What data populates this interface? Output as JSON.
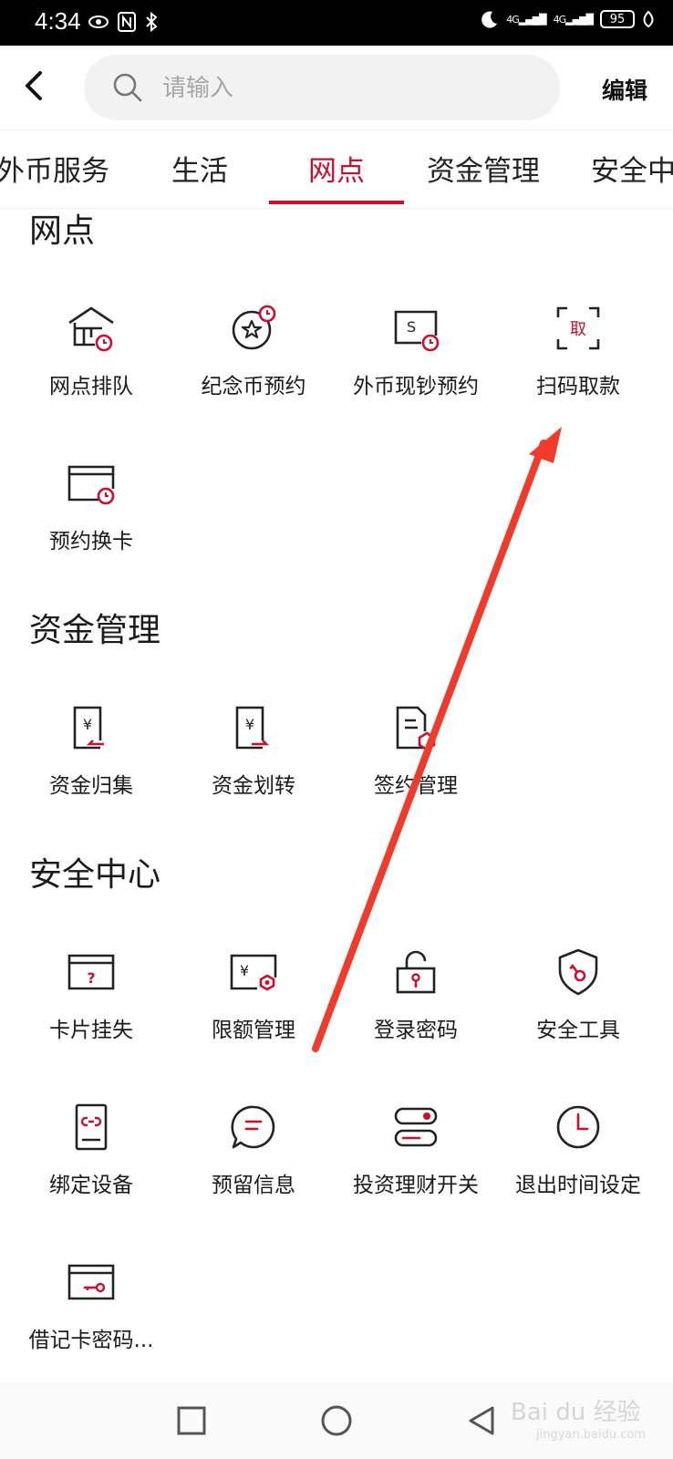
{
  "status_bar": {
    "time": "4:34",
    "network": "4G",
    "battery": "95"
  },
  "search": {
    "placeholder": "请输入"
  },
  "header": {
    "edit_label": "编辑"
  },
  "tabs": [
    "外币服务",
    "生活",
    "网点",
    "资金管理",
    "安全中"
  ],
  "active_tab": "网点",
  "colors": {
    "accent": "#c8102e",
    "text": "#1a1a1a",
    "icon": "#222222"
  },
  "sections": [
    {
      "title": "网点",
      "items": [
        {
          "label": "网点排队",
          "icon": "bank-queue-icon"
        },
        {
          "label": "纪念币预约",
          "icon": "commemorative-coin-icon"
        },
        {
          "label": "外币现钞预约",
          "icon": "foreign-cash-icon"
        },
        {
          "label": "扫码取款",
          "icon": "scan-withdraw-icon"
        },
        {
          "label": "预约换卡",
          "icon": "card-replace-icon"
        }
      ]
    },
    {
      "title": "资金管理",
      "items": [
        {
          "label": "资金归集",
          "icon": "fund-collect-icon"
        },
        {
          "label": "资金划转",
          "icon": "fund-transfer-icon"
        },
        {
          "label": "签约管理",
          "icon": "contract-icon"
        }
      ]
    },
    {
      "title": "安全中心",
      "items": [
        {
          "label": "卡片挂失",
          "icon": "card-loss-icon"
        },
        {
          "label": "限额管理",
          "icon": "limit-icon"
        },
        {
          "label": "登录密码",
          "icon": "login-lock-icon"
        },
        {
          "label": "安全工具",
          "icon": "shield-key-icon"
        },
        {
          "label": "绑定设备",
          "icon": "device-bind-icon"
        },
        {
          "label": "预留信息",
          "icon": "message-icon"
        },
        {
          "label": "投资理财开关",
          "icon": "toggle-switch-icon"
        },
        {
          "label": "退出时间设定",
          "icon": "clock-icon"
        },
        {
          "label": "借记卡密码...",
          "icon": "debit-card-key-icon"
        }
      ]
    }
  ],
  "annotation": {
    "arrow_color": "#f03a2a",
    "target": "扫码取款"
  },
  "watermark": {
    "text": "Bai du 经验",
    "sub": "jingyan.baidu.com"
  }
}
